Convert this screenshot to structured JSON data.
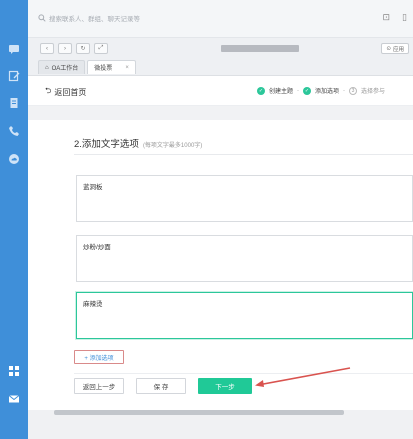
{
  "sidebar": {
    "items": [
      {
        "icon": "chat-icon"
      },
      {
        "icon": "edit-icon"
      },
      {
        "icon": "document-icon"
      },
      {
        "icon": "phone-icon"
      },
      {
        "icon": "cloud-icon"
      },
      {
        "icon": "grid-apps-icon"
      },
      {
        "icon": "mail-icon"
      }
    ],
    "color": "#3f8fd9"
  },
  "topbar": {
    "search_placeholder": "搜索联系人、群组、聊天记录等"
  },
  "browser": {
    "app_button_label": "应用",
    "tabs": [
      {
        "label": "OA工作台",
        "active": false
      },
      {
        "label": "微投票",
        "active": true
      }
    ]
  },
  "page": {
    "back_label": "返回首页",
    "steps": [
      {
        "label": "创建主题",
        "state": "done"
      },
      {
        "label": "添加选项",
        "state": "done"
      },
      {
        "label": "3",
        "text": "选择参与",
        "state": "todo"
      }
    ]
  },
  "section": {
    "title": "2.添加文字选项",
    "hint": "(每项文字最多1000字)"
  },
  "options": [
    {
      "value": "蓝洞板"
    },
    {
      "value": "炒粉/炒面"
    },
    {
      "value": "麻辣烫"
    }
  ],
  "actions": {
    "add_option": "+ 添加选项",
    "prev": "返回上一步",
    "save": "保 存",
    "next": "下一步"
  },
  "colors": {
    "accent": "#20c997",
    "link": "#3f8fd9",
    "annotation": "#d9534f"
  }
}
